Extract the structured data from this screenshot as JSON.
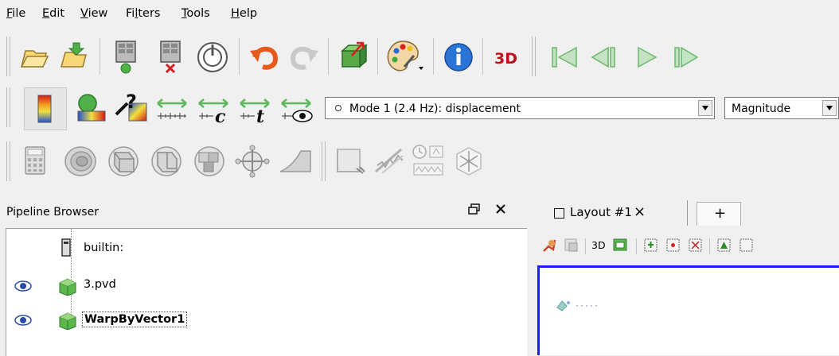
{
  "menu": [
    {
      "label": "File",
      "mnemonic": "F",
      "rest": "ile"
    },
    {
      "label": "Edit",
      "mnemonic": "E",
      "rest": "dit"
    },
    {
      "label": "View",
      "mnemonic": "V",
      "rest": "iew"
    },
    {
      "label": "Filters",
      "pre": "Fi",
      "mnemonic": "l",
      "rest": "ters"
    },
    {
      "label": "Tools",
      "mnemonic": "T",
      "rest": "ools"
    },
    {
      "label": "Help",
      "mnemonic": "H",
      "rest": "elp"
    }
  ],
  "toolbar_main": [
    "open-folder-icon",
    "load-state-icon",
    "connect-icon",
    "disconnect-icon",
    "reset-session-icon",
    "undo-icon",
    "redo-icon",
    "camera-link-icon",
    "color-palette-icon",
    "info-icon",
    "3d-icon",
    "first-frame-icon",
    "previous-frame-icon",
    "play-icon",
    "next-frame-icon"
  ],
  "toolbar_color": {
    "icons": [
      "color-map-icon",
      "edit-color-icon",
      "rescale-custom-icon",
      "rescale-range-icon",
      "rescale-custom-range-icon",
      "rescale-temporal-icon",
      "rescale-visible-icon"
    ],
    "array_combo": "Mode 1 (2.4 Hz): displacement",
    "component_combo": "Magnitude"
  },
  "toolbar_filters": [
    "calculator-icon",
    "contour-icon",
    "clip-icon",
    "slice-icon",
    "threshold-icon",
    "extract-subset-icon",
    "glyph-icon",
    "streamline-icon",
    "warp-by-vector-icon",
    "group-datasets-icon",
    "extract-level-icon"
  ],
  "pipeline": {
    "title": "Pipeline Browser",
    "items": [
      {
        "label": "builtin:",
        "icon": "server-icon"
      },
      {
        "label": "3.pvd",
        "icon": "source-cube-icon"
      },
      {
        "label": "WarpByVector1",
        "icon": "source-cube-icon"
      }
    ]
  },
  "layout": {
    "tab_label": "Layout #1",
    "close": "×",
    "add": "+",
    "view_toolbar_3d": "3D"
  },
  "colors": {
    "accent": "#1a1aff",
    "selection_text": "#000000"
  }
}
